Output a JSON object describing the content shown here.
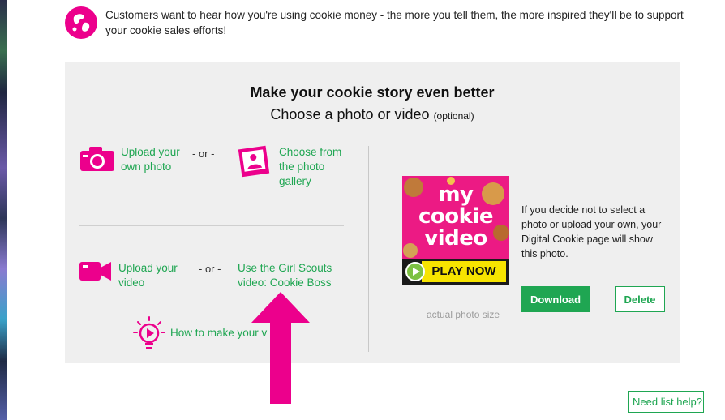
{
  "intro": {
    "text": "Customers want to hear how you're using cookie money - the more you tell them, the more inspired they'll be to support your cookie sales efforts!",
    "icon": "globe-icon"
  },
  "panel": {
    "title": "Make your cookie story even better",
    "subtitle": "Choose a photo or video",
    "subtitle_optional": "(optional)"
  },
  "options": {
    "upload_photo": {
      "label": "Upload your own photo",
      "icon": "camera-icon"
    },
    "or_label": "- or -",
    "gallery": {
      "label": "Choose from the photo gallery",
      "icon": "photo-frame-icon"
    },
    "upload_video": {
      "label": "Upload your video",
      "icon": "video-camera-icon"
    },
    "gs_video": {
      "label": "Use the Girl Scouts video: Cookie Boss"
    },
    "howto": {
      "label": "How to make your v",
      "icon": "lightbulb-play-icon"
    }
  },
  "preview": {
    "title_lines": [
      "my",
      "cookie",
      "video"
    ],
    "play_label": "PLAY NOW",
    "caption": "If you decide not to select a photo or upload your own, your Digital Cookie page will show this photo.",
    "actual_size": "actual photo size",
    "download_label": "Download",
    "delete_label": "Delete"
  },
  "help": {
    "label": "Need list help?"
  },
  "colors": {
    "accent_green": "#1fa652",
    "brand_pink": "#ec008c",
    "panel_bg": "#efefef",
    "play_yellow": "#f7e400"
  }
}
